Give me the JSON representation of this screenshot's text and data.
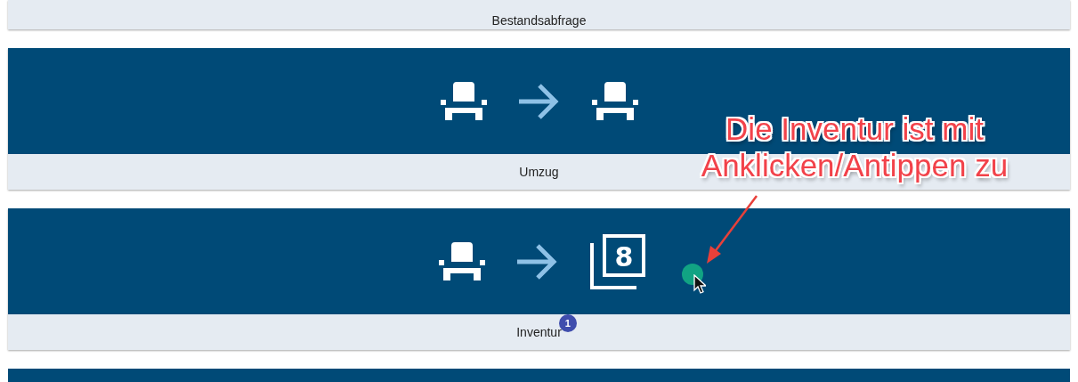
{
  "tiles": [
    {
      "kind": "label_only",
      "label": "Bestandsabfrage"
    },
    {
      "kind": "tile",
      "icons": [
        {
          "kind": "chair"
        },
        {
          "kind": "arrow"
        },
        {
          "kind": "chair"
        }
      ],
      "label": "Umzug"
    },
    {
      "kind": "tile",
      "icons": [
        {
          "kind": "chair"
        },
        {
          "kind": "arrow"
        },
        {
          "kind": "counter",
          "text": "8"
        }
      ],
      "label": "Inventur",
      "badge": "1"
    },
    {
      "kind": "cut"
    }
  ],
  "annotation": {
    "lines": [
      "Die Inventur ist mit",
      "Anklicken/Antippen zu"
    ]
  }
}
